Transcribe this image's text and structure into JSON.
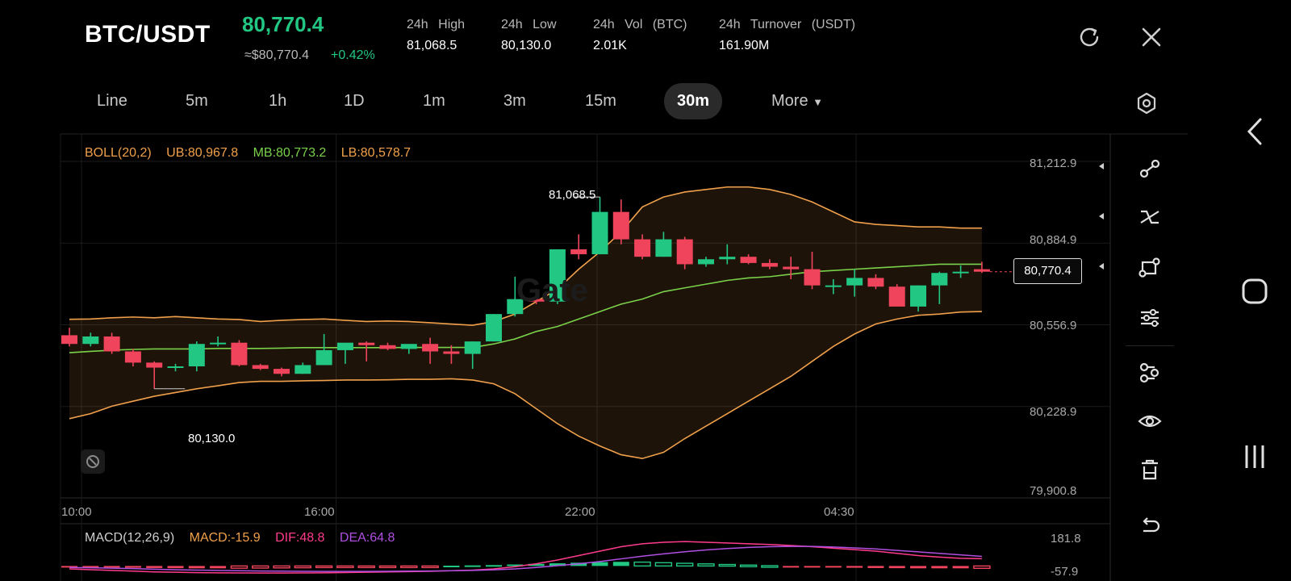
{
  "header": {
    "pair": "BTC/USDT",
    "last_price": "80,770.4",
    "approx_usd": "≈$80,770.4",
    "change": "+0.42%",
    "stats": [
      {
        "label": "24h High",
        "value": "81,068.5"
      },
      {
        "label": "24h Low",
        "value": "80,130.0"
      },
      {
        "label": "24h Vol (BTC)",
        "value": "2.01K"
      },
      {
        "label": "24h Turnover (USDT)",
        "value": "161.90M"
      }
    ]
  },
  "timeframes": {
    "items": [
      "Line",
      "5m",
      "1h",
      "1D",
      "1m",
      "3m",
      "15m",
      "30m"
    ],
    "active": "30m",
    "more": "More"
  },
  "boll": {
    "name": "BOLL(20,2)",
    "ub": "UB:80,967.8",
    "mb": "MB:80,773.2",
    "lb": "LB:80,578.7"
  },
  "price_axis": [
    "81,212.9",
    "80,884.9",
    "80,556.9",
    "80,228.9",
    "79,900.8"
  ],
  "time_axis": [
    "10:00",
    "16:00",
    "22:00",
    "04:30"
  ],
  "annotations": {
    "high": "81,068.5",
    "low": "80,130.0",
    "current": "80,770.4"
  },
  "watermark": "Gate",
  "macd": {
    "name": "MACD(12,26,9)",
    "macd": "MACD:-15.9",
    "dif": "DIF:48.8",
    "dea": "DEA:64.8",
    "axis_top": "181.8",
    "axis_bottom": "-57.9"
  },
  "colors": {
    "up": "#21c782",
    "down": "#f0435c",
    "boll_band": "#f0a04b",
    "mid_line": "#7ad14a",
    "dif": "#ff3b8b",
    "dea": "#b04fe0"
  },
  "chart_data": {
    "type": "candlestick",
    "interval": "30m",
    "ylim": [
      79900.8,
      81212.9
    ],
    "candles": [
      {
        "o": 80515,
        "h": 80545,
        "l": 80470,
        "c": 80480
      },
      {
        "o": 80480,
        "h": 80525,
        "l": 80470,
        "c": 80510
      },
      {
        "o": 80510,
        "h": 80525,
        "l": 80440,
        "c": 80450
      },
      {
        "o": 80450,
        "h": 80460,
        "l": 80390,
        "c": 80405
      },
      {
        "o": 80405,
        "h": 80410,
        "l": 80300,
        "c": 80385
      },
      {
        "o": 80385,
        "h": 80400,
        "l": 80370,
        "c": 80390
      },
      {
        "o": 80390,
        "h": 80490,
        "l": 80370,
        "c": 80480
      },
      {
        "o": 80480,
        "h": 80510,
        "l": 80470,
        "c": 80485
      },
      {
        "o": 80485,
        "h": 80495,
        "l": 80390,
        "c": 80395
      },
      {
        "o": 80395,
        "h": 80400,
        "l": 80375,
        "c": 80380
      },
      {
        "o": 80380,
        "h": 80385,
        "l": 80350,
        "c": 80360
      },
      {
        "o": 80360,
        "h": 80405,
        "l": 80360,
        "c": 80395
      },
      {
        "o": 80395,
        "h": 80520,
        "l": 80395,
        "c": 80455
      },
      {
        "o": 80455,
        "h": 80475,
        "l": 80400,
        "c": 80485
      },
      {
        "o": 80485,
        "h": 80490,
        "l": 80410,
        "c": 80475
      },
      {
        "o": 80475,
        "h": 80485,
        "l": 80455,
        "c": 80460
      },
      {
        "o": 80460,
        "h": 80470,
        "l": 80440,
        "c": 80480
      },
      {
        "o": 80480,
        "h": 80505,
        "l": 80400,
        "c": 80450
      },
      {
        "o": 80450,
        "h": 80475,
        "l": 80400,
        "c": 80440
      },
      {
        "o": 80440,
        "h": 80490,
        "l": 80380,
        "c": 80490
      },
      {
        "o": 80490,
        "h": 80600,
        "l": 80490,
        "c": 80600
      },
      {
        "o": 80600,
        "h": 80750,
        "l": 80590,
        "c": 80660
      },
      {
        "o": 80660,
        "h": 80700,
        "l": 80640,
        "c": 80650
      },
      {
        "o": 80650,
        "h": 80860,
        "l": 80640,
        "c": 80860
      },
      {
        "o": 80860,
        "h": 80920,
        "l": 80820,
        "c": 80840
      },
      {
        "o": 80840,
        "h": 81070,
        "l": 80840,
        "c": 81010
      },
      {
        "o": 81010,
        "h": 81060,
        "l": 80880,
        "c": 80900
      },
      {
        "o": 80900,
        "h": 80920,
        "l": 80820,
        "c": 80830
      },
      {
        "o": 80830,
        "h": 80930,
        "l": 80830,
        "c": 80900
      },
      {
        "o": 80900,
        "h": 80910,
        "l": 80780,
        "c": 80800
      },
      {
        "o": 80800,
        "h": 80830,
        "l": 80790,
        "c": 80820
      },
      {
        "o": 80820,
        "h": 80880,
        "l": 80800,
        "c": 80830
      },
      {
        "o": 80830,
        "h": 80840,
        "l": 80800,
        "c": 80805
      },
      {
        "o": 80805,
        "h": 80820,
        "l": 80780,
        "c": 80790
      },
      {
        "o": 80790,
        "h": 80830,
        "l": 80740,
        "c": 80780
      },
      {
        "o": 80780,
        "h": 80850,
        "l": 80700,
        "c": 80715
      },
      {
        "o": 80715,
        "h": 80740,
        "l": 80680,
        "c": 80715
      },
      {
        "o": 80715,
        "h": 80780,
        "l": 80670,
        "c": 80745
      },
      {
        "o": 80745,
        "h": 80760,
        "l": 80700,
        "c": 80710
      },
      {
        "o": 80710,
        "h": 80720,
        "l": 80630,
        "c": 80630
      },
      {
        "o": 80630,
        "h": 80715,
        "l": 80610,
        "c": 80715
      },
      {
        "o": 80715,
        "h": 80770,
        "l": 80640,
        "c": 80765
      },
      {
        "o": 80765,
        "h": 80795,
        "l": 80745,
        "c": 80770
      },
      {
        "o": 80780,
        "h": 80810,
        "l": 80765,
        "c": 80770
      }
    ],
    "boll_upper": [
      80579,
      80580,
      80585,
      80588,
      80585,
      80590,
      80585,
      80580,
      80578,
      80570,
      80575,
      80578,
      80580,
      80575,
      80570,
      80572,
      80570,
      80565,
      80560,
      80555,
      80570,
      80600,
      80650,
      80700,
      80780,
      80850,
      80930,
      81030,
      81070,
      81090,
      81100,
      81110,
      81110,
      81100,
      81080,
      81050,
      81010,
      80970,
      80960,
      80955,
      80950,
      80950,
      80945,
      80945
    ],
    "boll_mid": [
      80445,
      80450,
      80455,
      80458,
      80460,
      80460,
      80460,
      80462,
      80462,
      80462,
      80463,
      80465,
      80465,
      80465,
      80465,
      80465,
      80466,
      80466,
      80466,
      80466,
      80480,
      80500,
      80530,
      80550,
      80580,
      80610,
      80640,
      80660,
      80690,
      80705,
      80720,
      80735,
      80745,
      80750,
      80760,
      80770,
      80775,
      80780,
      80785,
      80790,
      80795,
      80800,
      80800,
      80800
    ],
    "boll_lower": [
      80180,
      80200,
      80230,
      80250,
      80270,
      80285,
      80300,
      80312,
      80325,
      80330,
      80330,
      80332,
      80333,
      80335,
      80335,
      80336,
      80338,
      80338,
      80340,
      80335,
      80320,
      80280,
      80220,
      80160,
      80110,
      80070,
      80035,
      80020,
      80045,
      80100,
      80150,
      80200,
      80250,
      80300,
      80350,
      80410,
      80470,
      80520,
      80560,
      80580,
      80595,
      80600,
      80608,
      80610
    ],
    "macd_hist": [
      -5,
      -8,
      -10,
      -12,
      -14,
      -15,
      -16,
      -16,
      -15,
      -14,
      -13,
      -12,
      -10,
      -8,
      -6,
      -4,
      -2,
      -1,
      2,
      4,
      6,
      10,
      14,
      18,
      22,
      26,
      28,
      26,
      22,
      18,
      14,
      10,
      6,
      2,
      -2,
      -6,
      -10,
      -12,
      -14,
      -15,
      -16,
      -16,
      -16,
      -15.9
    ],
    "dif": [
      -20,
      -25,
      -30,
      -35,
      -40,
      -42,
      -45,
      -46,
      -47,
      -48,
      -48,
      -47,
      -46,
      -44,
      -42,
      -40,
      -38,
      -36,
      -32,
      -28,
      -20,
      -5,
      15,
      40,
      70,
      100,
      130,
      150,
      160,
      165,
      160,
      155,
      150,
      145,
      138,
      130,
      120,
      110,
      100,
      85,
      70,
      60,
      52,
      48.8
    ],
    "dea": [
      -10,
      -12,
      -15,
      -18,
      -22,
      -25,
      -28,
      -30,
      -32,
      -34,
      -35,
      -36,
      -37,
      -37,
      -37,
      -36,
      -35,
      -34,
      -32,
      -30,
      -26,
      -20,
      -10,
      2,
      15,
      30,
      48,
      66,
      82,
      96,
      108,
      118,
      125,
      130,
      132,
      132,
      128,
      122,
      115,
      105,
      95,
      85,
      75,
      64.8
    ],
    "macd_ylim": [
      -57.9,
      181.8
    ]
  }
}
